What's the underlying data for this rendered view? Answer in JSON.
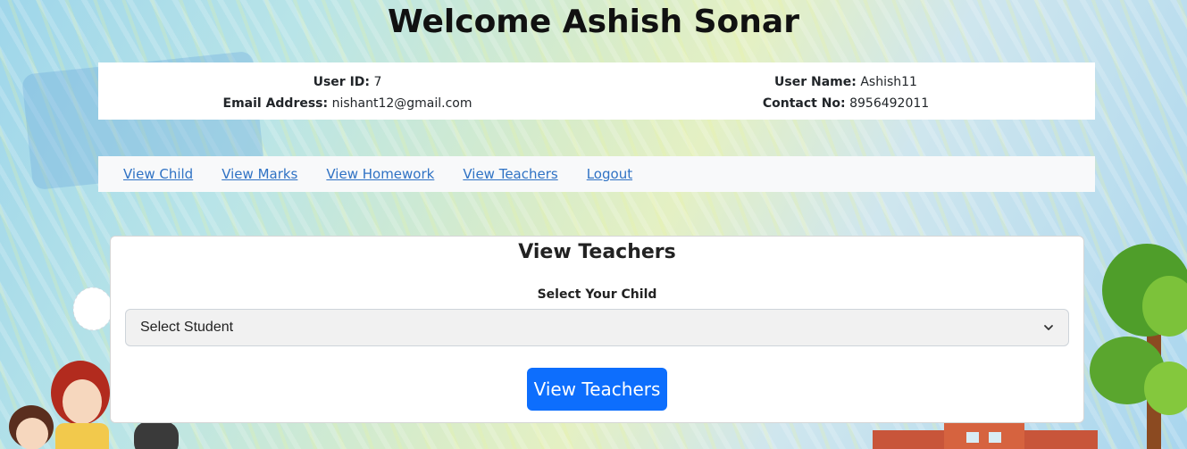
{
  "header": {
    "title": "Welcome Ashish Sonar"
  },
  "user_info": {
    "user_id_label": "User ID:",
    "user_id": "7",
    "email_label": "Email Address:",
    "email": "nishant12@gmail.com",
    "user_name_label": "User Name:",
    "user_name": "Ashish11",
    "contact_label": "Contact No:",
    "contact": "8956492011"
  },
  "nav": {
    "items": [
      {
        "label": "View Child"
      },
      {
        "label": "View Marks"
      },
      {
        "label": "View Homework"
      },
      {
        "label": "View Teachers"
      },
      {
        "label": "Logout"
      }
    ]
  },
  "panel": {
    "title": "View Teachers",
    "select_label": "Select Your Child",
    "select_value": "Select Student",
    "submit_label": "View Teachers"
  },
  "colors": {
    "primary_button": "#0d6efd",
    "nav_link": "#2f72c4"
  },
  "icons": {
    "select_arrow": "chevron-down-icon"
  }
}
